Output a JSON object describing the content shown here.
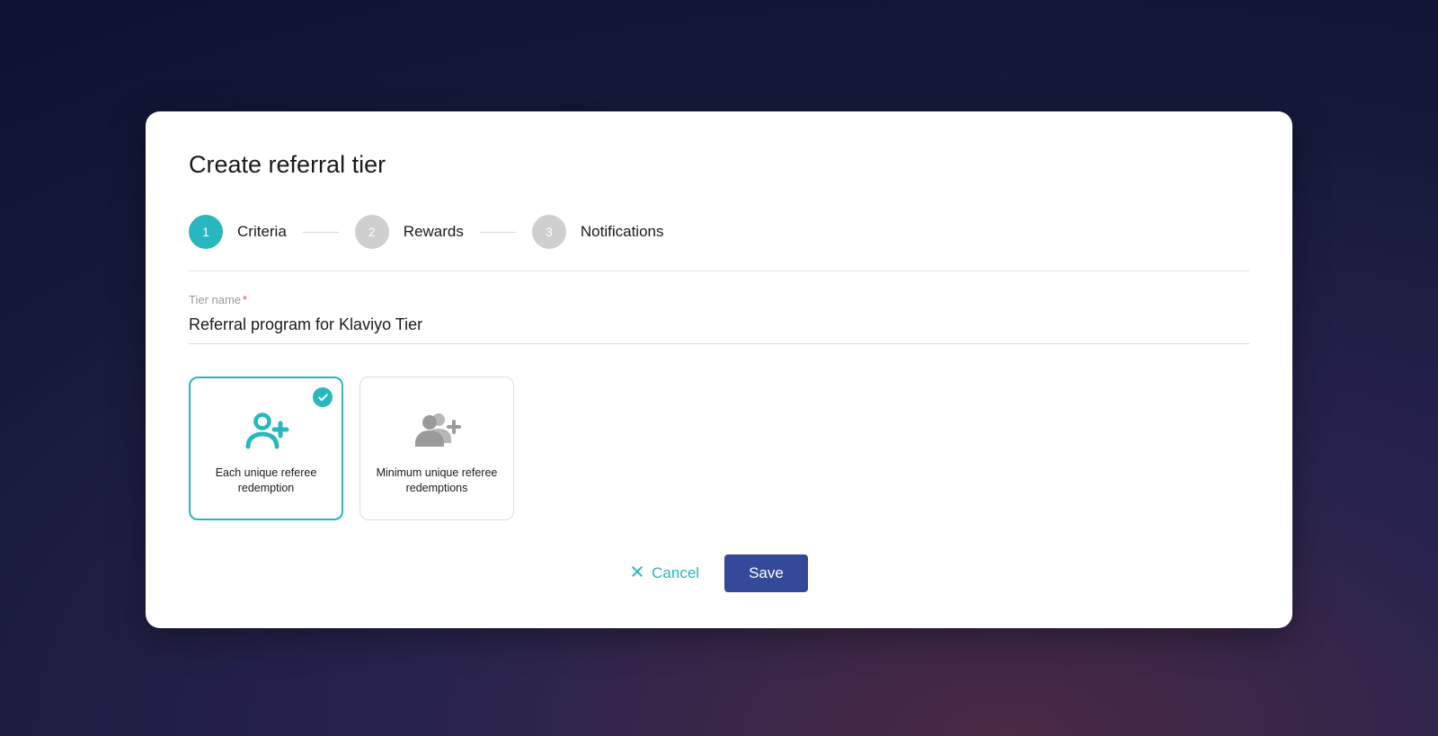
{
  "title": "Create referral tier",
  "stepper": {
    "steps": [
      {
        "num": "1",
        "label": "Criteria",
        "active": true
      },
      {
        "num": "2",
        "label": "Rewards",
        "active": false
      },
      {
        "num": "3",
        "label": "Notifications",
        "active": false
      }
    ]
  },
  "form": {
    "tier_name_label": "Tier name",
    "tier_name_value": "Referral program for Klaviyo Tier"
  },
  "options": [
    {
      "label": "Each unique referee redemption",
      "selected": true
    },
    {
      "label": "Minimum unique referee redemptions",
      "selected": false
    }
  ],
  "actions": {
    "cancel": "Cancel",
    "save": "Save"
  }
}
